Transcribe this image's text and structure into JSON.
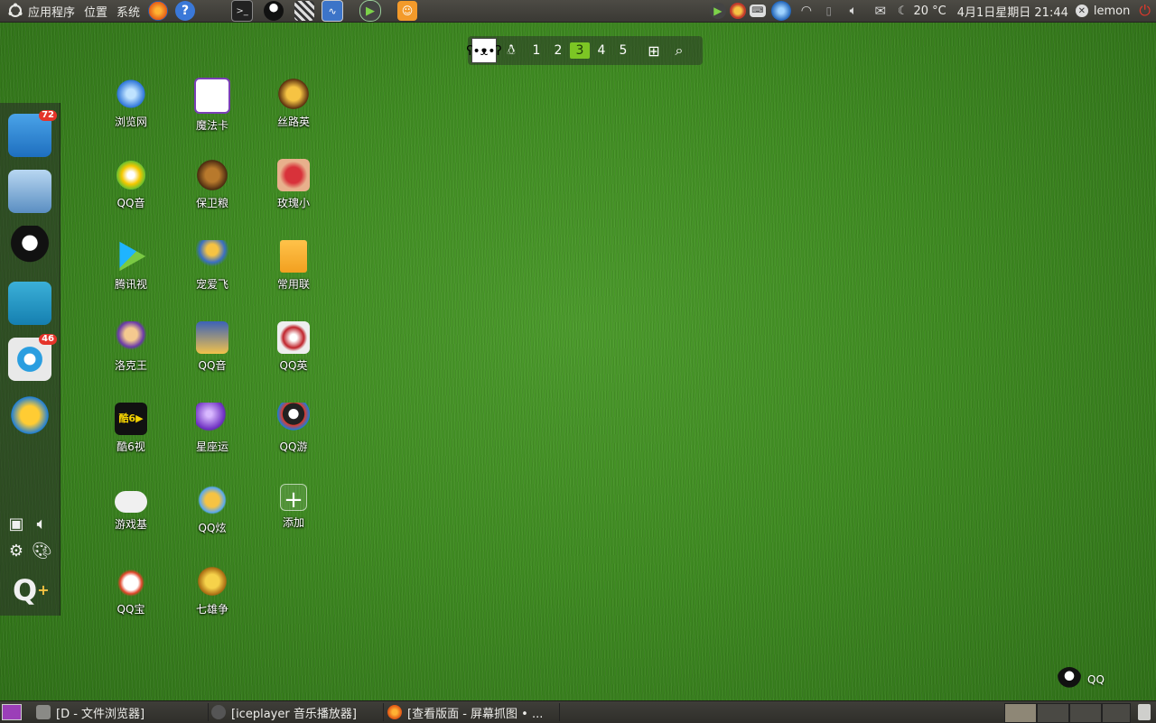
{
  "top_panel": {
    "menus": [
      "应用程序",
      "位置",
      "系统"
    ],
    "temperature": "20 °C",
    "datetime": "4月1日星期日 21:44",
    "user": "lemon"
  },
  "workspace": {
    "numbers": [
      "1",
      "2",
      "3",
      "4",
      "5"
    ],
    "active": "3"
  },
  "dock": {
    "store_badge": "72",
    "browser_badge": "46"
  },
  "desktop": {
    "icons": [
      "浏览网",
      "魔法卡",
      "丝路英",
      "QQ音",
      "保卫粮",
      "玫瑰小",
      "腾讯视",
      "宠爱飞",
      "常用联",
      "洛克王",
      "QQ音",
      "QQ英",
      "酷6视",
      "星座运",
      "QQ游",
      "游戏基",
      "QQ炫",
      "添加",
      "QQ宝",
      "七雄争"
    ]
  },
  "qq_corner": {
    "label": "QQ"
  },
  "taskbar": {
    "tasks": [
      "[D - 文件浏览器]",
      "[iceplayer 音乐播放器]",
      "[查看版面 - 屏幕抓图 • ..."
    ]
  }
}
